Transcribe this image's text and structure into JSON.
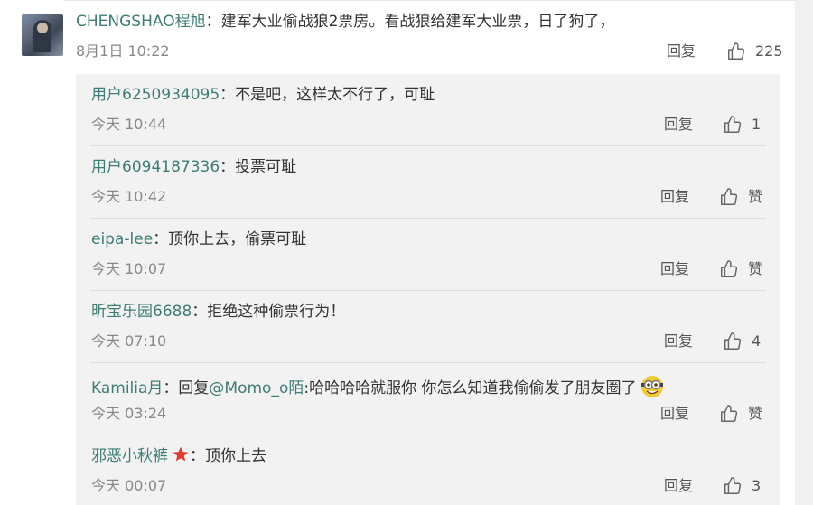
{
  "main_comment": {
    "username": "CHENGSHAO程旭",
    "text": "建军大业偷战狼2票房。看战狼给建军大业票，日了狗了，",
    "time": "8月1日 10:22",
    "reply_label": "回复",
    "likes": "225"
  },
  "colon": "：",
  "replies": [
    {
      "username": "用户6250934095",
      "text": "不是吧，这样太不行了，可耻",
      "time": "今天 10:44",
      "reply_label": "回复",
      "likes": "1"
    },
    {
      "username": "用户6094187336",
      "text": "投票可耻",
      "time": "今天 10:42",
      "reply_label": "回复",
      "likes": "赞"
    },
    {
      "username": "eipa-lee",
      "text": "顶你上去，偷票可耻",
      "time": "今天 10:07",
      "reply_label": "回复",
      "likes": "赞"
    },
    {
      "username": "昕宝乐园6688",
      "text": "拒绝这种偷票行为！",
      "time": "今天 07:10",
      "reply_label": "回复",
      "likes": "4"
    },
    {
      "username": "Kamilia月",
      "text_prefix": "回复",
      "mention": "@Momo_o陌",
      "text": ":哈哈哈哈就服你 你怎么知道我偷偷发了朋友圈了",
      "time": "今天 03:24",
      "reply_label": "回复",
      "likes": "赞"
    },
    {
      "username": "邪恶小秋裤",
      "text": "顶你上去",
      "time": "今天 00:07",
      "reply_label": "回复",
      "likes": "3"
    }
  ],
  "colors": {
    "username": "#3e7d75",
    "text": "#333333",
    "meta": "#888888",
    "reply_bg": "#f2f2f2",
    "badge_star": "#e03c31"
  },
  "icons": {
    "like": "thumbs-up-outline-icon",
    "badge": "red-star-icon",
    "emoji": "minion-emoji-icon"
  }
}
